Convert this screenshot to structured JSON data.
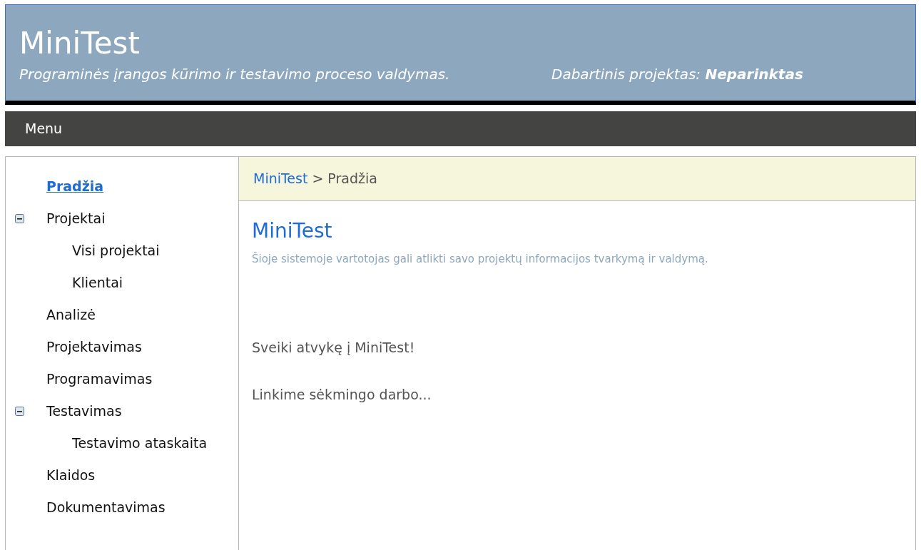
{
  "header": {
    "title": "MiniTest",
    "subtitle": "Programinės įrangos kūrimo ir testavimo proceso valdymas.",
    "project_label": "Dabartinis projektas:",
    "project_value": "Neparinktas"
  },
  "menu_bar": {
    "label": "Menu"
  },
  "sidebar": {
    "items": [
      {
        "label": "Pradžia",
        "selected": true
      },
      {
        "label": "Projektai",
        "selected": false,
        "expanded": true,
        "children": [
          {
            "label": "Visi projektai",
            "selected": false
          },
          {
            "label": "Klientai",
            "selected": false
          }
        ]
      },
      {
        "label": "Analizė",
        "selected": false
      },
      {
        "label": "Projektavimas",
        "selected": false
      },
      {
        "label": "Programavimas",
        "selected": false
      },
      {
        "label": "Testavimas",
        "selected": false,
        "expanded": true,
        "children": [
          {
            "label": "Testavimo ataskaita",
            "selected": false
          }
        ]
      },
      {
        "label": "Klaidos",
        "selected": false
      },
      {
        "label": "Dokumentavimas",
        "selected": false
      }
    ]
  },
  "breadcrumb": {
    "link": "MiniTest",
    "separator": ">",
    "current": "Pradžia"
  },
  "content": {
    "heading": "MiniTest",
    "description": "Šioje sistemoje vartotojas gali atlikti savo projektų informacijos tvarkymą ir valdymą.",
    "paragraphs": [
      "Sveiki atvykę į MiniTest!",
      "Linkime sėkmingo darbo..."
    ]
  }
}
